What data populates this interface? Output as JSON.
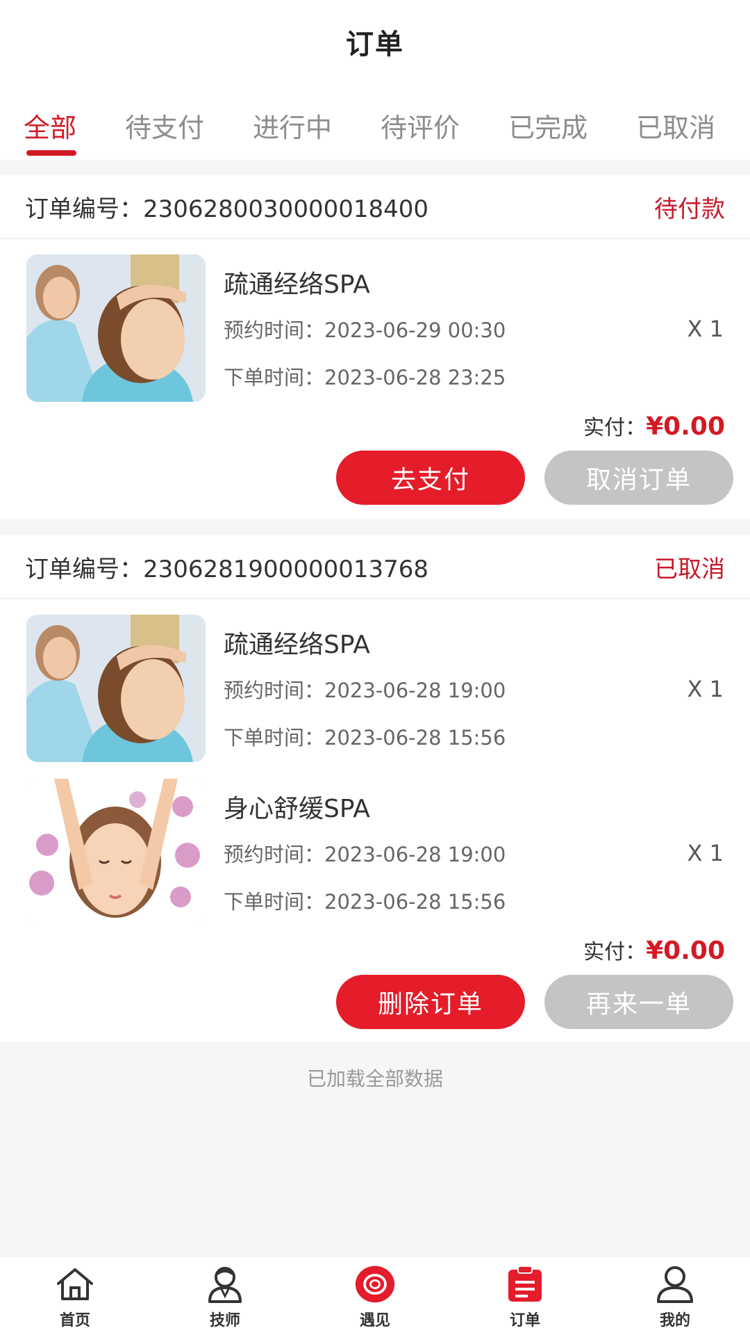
{
  "header": {
    "title": "订单"
  },
  "tabs": [
    {
      "label": "全部",
      "active": true
    },
    {
      "label": "待支付"
    },
    {
      "label": "进行中"
    },
    {
      "label": "待评价"
    },
    {
      "label": "已完成"
    },
    {
      "label": "已取消"
    }
  ],
  "colors": {
    "accent": "#d21a26",
    "button_red": "#e51c2a",
    "button_gray": "#c4c4c4"
  },
  "orders": [
    {
      "number_label": "订单编号：2306280030000018400",
      "status": "待付款",
      "items": [
        {
          "name": "疏通经络SPA",
          "booking": "预约时间：2023-06-29 00:30",
          "ordered": "下单时间：2023-06-28 23:25",
          "qty": "X 1",
          "image": "massage-photo"
        }
      ],
      "pay_label": "实付：",
      "pay_amount": "¥0.00",
      "buttons": {
        "primary": "去支付",
        "secondary": "取消订单"
      }
    },
    {
      "number_label": "订单编号：2306281900000013768",
      "status": "已取消",
      "items": [
        {
          "name": "疏通经络SPA",
          "booking": "预约时间：2023-06-28 19:00",
          "ordered": "下单时间：2023-06-28 15:56",
          "qty": "X 1",
          "image": "massage-photo"
        },
        {
          "name": "身心舒缓SPA",
          "booking": "预约时间：2023-06-28 19:00",
          "ordered": "下单时间：2023-06-28 15:56",
          "qty": "X 1",
          "image": "face-massage-illustration"
        }
      ],
      "pay_label": "实付：",
      "pay_amount": "¥0.00",
      "buttons": {
        "primary": "删除订单",
        "secondary": "再来一单"
      }
    }
  ],
  "footer_note": "已加载全部数据",
  "bottom_nav": [
    {
      "label": "首页",
      "icon": "home-icon"
    },
    {
      "label": "技师",
      "icon": "technician-icon"
    },
    {
      "label": "遇见",
      "icon": "meet-icon"
    },
    {
      "label": "订单",
      "icon": "orders-icon",
      "active": true
    },
    {
      "label": "我的",
      "icon": "profile-icon"
    }
  ]
}
